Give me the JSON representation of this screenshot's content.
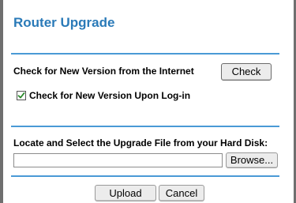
{
  "page": {
    "title": "Router Upgrade"
  },
  "online_check": {
    "label": "Check for New Version from the Internet",
    "check_button": "Check",
    "login_checkbox_label": "Check for New Version Upon Log-in",
    "login_checkbox_checked": true
  },
  "file_upgrade": {
    "label": "Locate and Select the Upgrade File from your Hard Disk:",
    "file_value": "",
    "browse_button": "Browse..."
  },
  "actions": {
    "upload_button": "Upload",
    "cancel_button": "Cancel"
  },
  "colors": {
    "title": "#2a7ab8",
    "divider": "#4a9ad6",
    "checkmark": "#2d8a2d"
  }
}
